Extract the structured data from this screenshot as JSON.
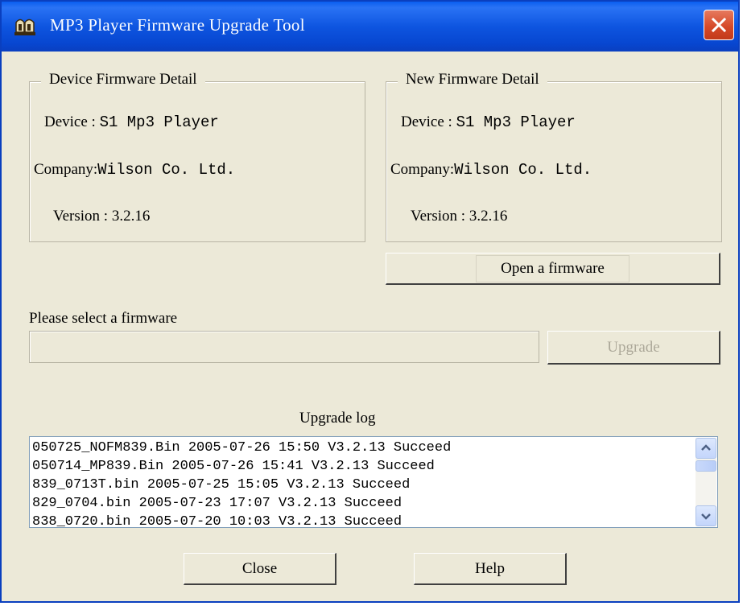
{
  "window": {
    "title": "MP3 Player  Firmware Upgrade Tool",
    "icon": "app-icon",
    "close_icon": "close-icon",
    "title_color": "#0a5ef0",
    "close_color": "#d64a2a"
  },
  "device_detail": {
    "group_title": "Device Firmware Detail",
    "device_label": "Device : ",
    "device_value": "S1 Mp3 Player",
    "company_label": "Company:",
    "company_value": "Wilson Co.  Ltd.",
    "version_label": "Version  : ",
    "version_value": "3.2.16"
  },
  "new_detail": {
    "group_title": "New Firmware Detail",
    "device_label": "Device : ",
    "device_value": "S1 Mp3 Player",
    "company_label": "Company:",
    "company_value": "Wilson Co.  Ltd.",
    "version_label": "Version  : ",
    "version_value": "3.2.16"
  },
  "open_button": "Open a firmware",
  "select_label": "Please select a  firmware",
  "firmware_path": "",
  "upgrade_button": "Upgrade",
  "log_label": "Upgrade log",
  "log_lines": [
    "050725_NOFM839.Bin  2005-07-26  15:50  V3.2.13 Succeed",
    "050714_MP839.Bin  2005-07-26  15:41  V3.2.13 Succeed",
    "839_0713T.bin  2005-07-25  15:05  V3.2.13 Succeed",
    "829_0704.bin  2005-07-23  17:07  V3.2.13 Succeed",
    "838_0720.bin  2005-07-20  10:03  V3.2.13 Succeed"
  ],
  "scroll_up_icon": "chevron-up-icon",
  "scroll_down_icon": "chevron-down-icon",
  "close_button": "Close",
  "help_button": "Help"
}
